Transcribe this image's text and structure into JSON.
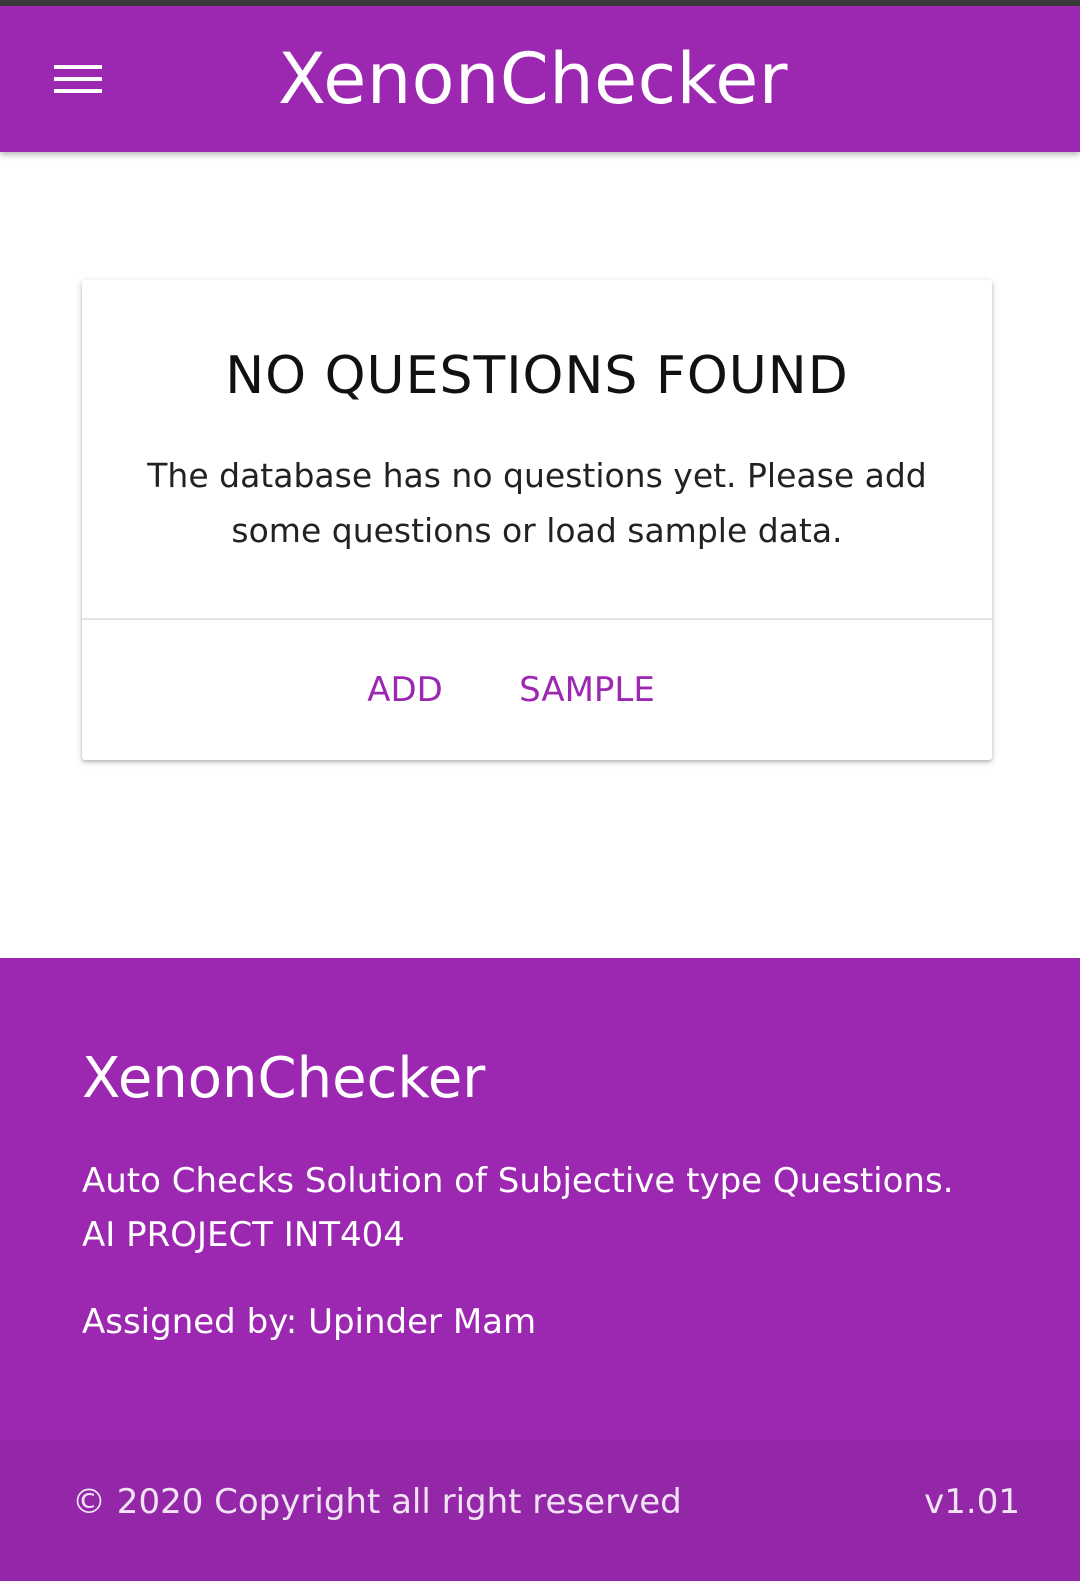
{
  "app_bar": {
    "title": "XenonChecker",
    "menu_icon": "hamburger-menu-icon"
  },
  "empty_card": {
    "title": "NO QUESTIONS FOUND",
    "message": "The database has no questions yet. Please add some questions or load sample data.",
    "actions": {
      "add_label": "ADD",
      "sample_label": "SAMPLE"
    }
  },
  "footer": {
    "title": "XenonChecker",
    "description_line1": "Auto Checks Solution of Subjective type Questions.",
    "description_line2": "AI PROJECT INT404",
    "assigned_by": "Assigned by: Upinder Mam",
    "copyright": "© 2020 Copyright all right reserved",
    "version": "v1.01"
  },
  "colors": {
    "primary": "#9c27b0",
    "copyright_bar": "#9327a8",
    "card_background": "#ffffff",
    "status_strip": "#3a3a3a"
  }
}
